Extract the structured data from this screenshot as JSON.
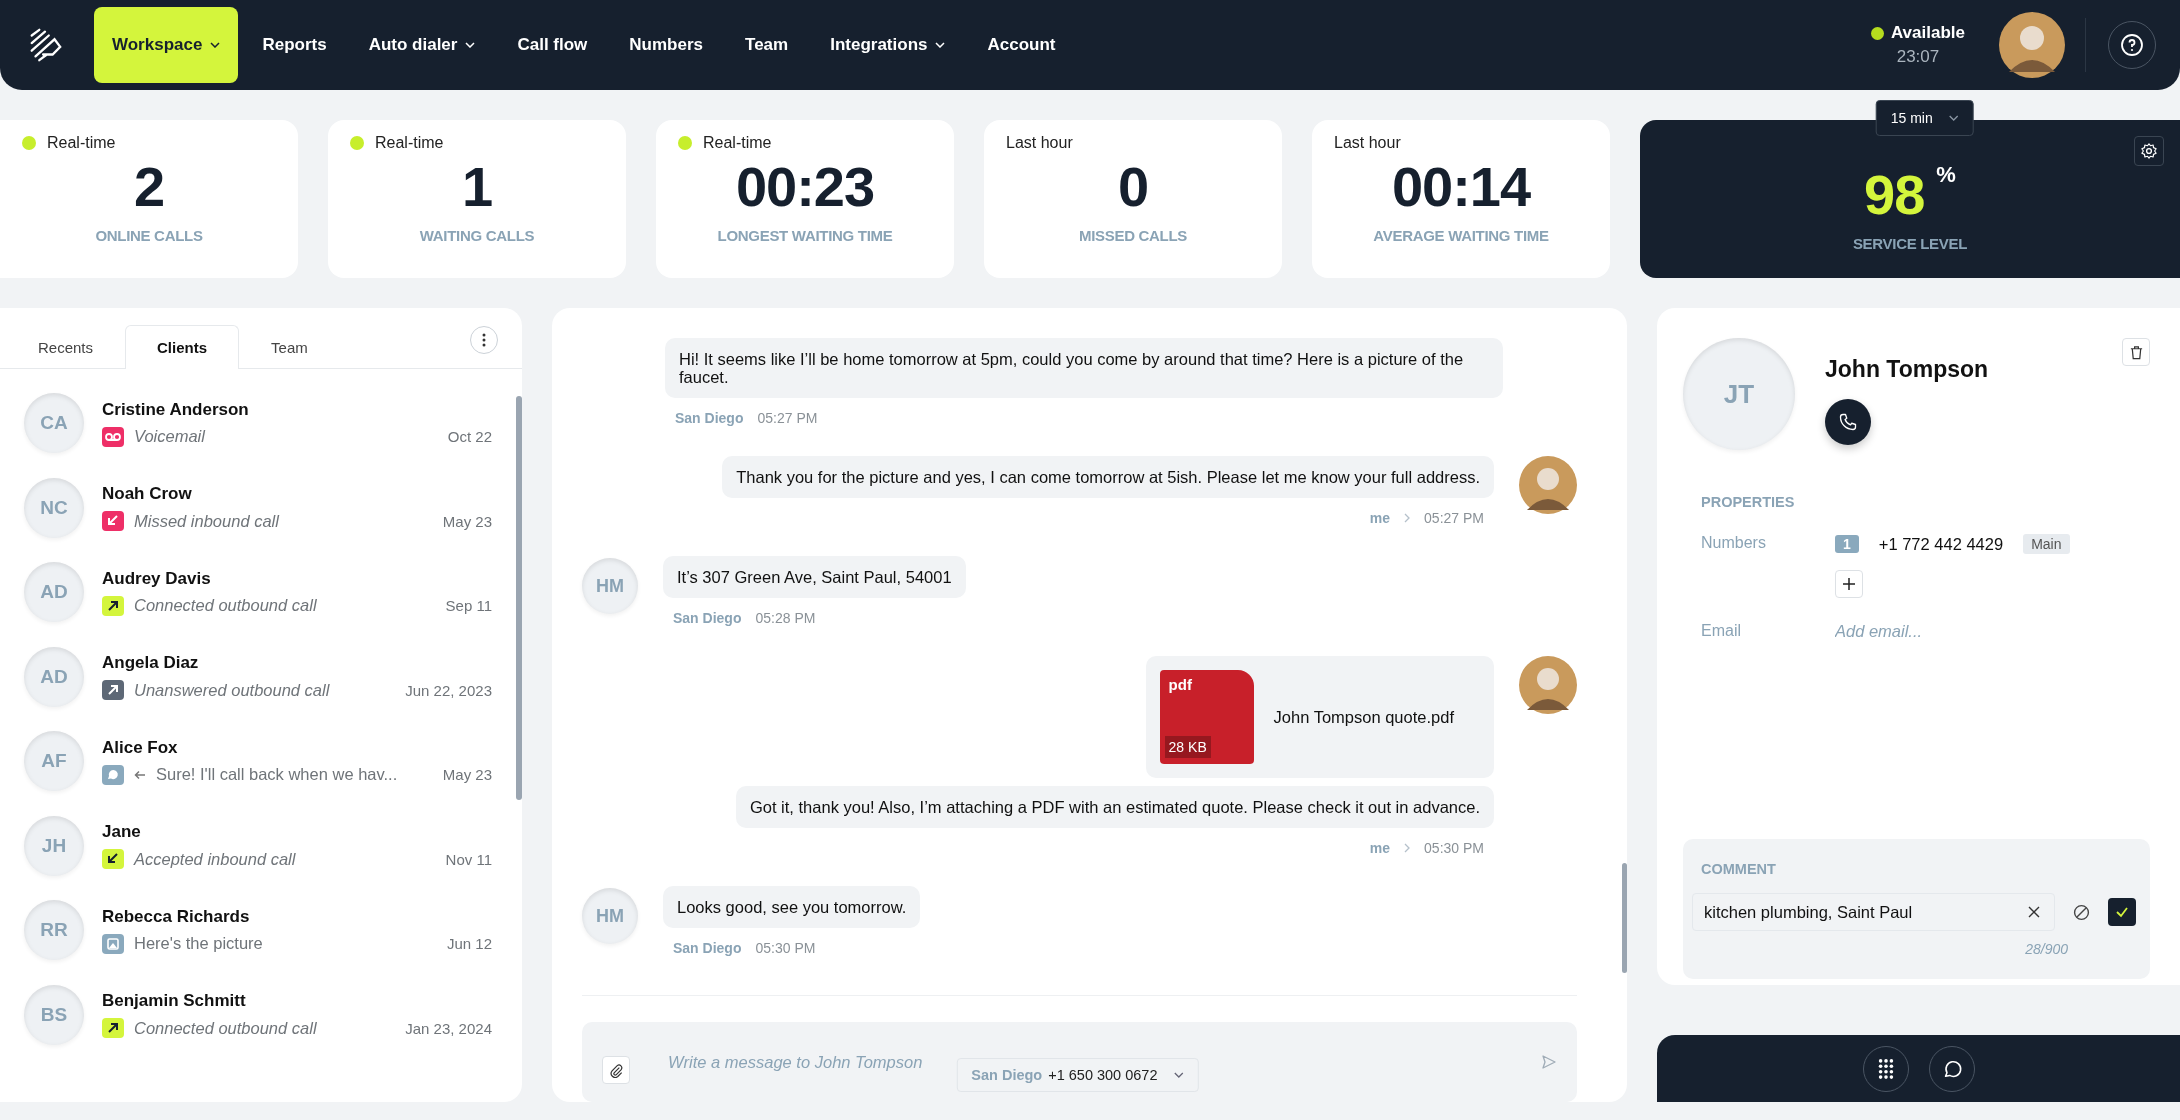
{
  "nav": {
    "items": [
      {
        "label": "Workspace",
        "selected": true,
        "dropdown": true
      },
      {
        "label": "Reports",
        "selected": false,
        "dropdown": false
      },
      {
        "label": "Auto dialer",
        "selected": false,
        "dropdown": true
      },
      {
        "label": "Call flow",
        "selected": false,
        "dropdown": false
      },
      {
        "label": "Numbers",
        "selected": false,
        "dropdown": false
      },
      {
        "label": "Team",
        "selected": false,
        "dropdown": false
      },
      {
        "label": "Integrations",
        "selected": false,
        "dropdown": true
      },
      {
        "label": "Account",
        "selected": false,
        "dropdown": false
      }
    ],
    "status": {
      "label": "Available",
      "time": "23:07",
      "color": "#b5dc1e"
    }
  },
  "stats": [
    {
      "period": "Real-time",
      "live": true,
      "value": "2",
      "label": "ONLINE CALLS"
    },
    {
      "period": "Real-time",
      "live": true,
      "value": "1",
      "label": "WAITING CALLS"
    },
    {
      "period": "Real-time",
      "live": true,
      "value": "00:23",
      "label": "LONGEST WAITING TIME"
    },
    {
      "period": "Last hour",
      "live": false,
      "value": "0",
      "label": "MISSED CALLS"
    },
    {
      "period": "Last hour",
      "live": false,
      "value": "00:14",
      "label": "AVERAGE WAITING TIME"
    }
  ],
  "service_level": {
    "interval": "15 min",
    "value": "98",
    "unit": "%",
    "label": "SERVICE LEVEL"
  },
  "contacts": {
    "tabs": [
      {
        "label": "Recents",
        "selected": false
      },
      {
        "label": "Clients",
        "selected": true
      },
      {
        "label": "Team",
        "selected": false
      }
    ],
    "items": [
      {
        "initials": "CA",
        "name": "Cristine Anderson",
        "kind": "voicemail",
        "status": "Voicemail",
        "date": "Oct 22"
      },
      {
        "initials": "NC",
        "name": "Noah Crow",
        "kind": "missed_inbound",
        "status": "Missed inbound call",
        "date": "May 23"
      },
      {
        "initials": "AD",
        "name": "Audrey Davis",
        "kind": "connected_outbound",
        "status": "Connected outbound call",
        "date": "Sep 11"
      },
      {
        "initials": "AD",
        "name": "Angela Diaz",
        "kind": "unanswered_outbound",
        "status": "Unanswered outbound call",
        "date": "Jun 22, 2023"
      },
      {
        "initials": "AF",
        "name": "Alice Fox",
        "kind": "message",
        "status": "Sure! I'll call back when we hav...",
        "date": "May 23"
      },
      {
        "initials": "JH",
        "name": "Jane",
        "kind": "accepted_inbound",
        "status": "Accepted inbound call",
        "date": "Nov 11"
      },
      {
        "initials": "RR",
        "name": "Rebecca Richards",
        "kind": "image",
        "status": "Here's the picture",
        "date": "Jun 12"
      },
      {
        "initials": "BS",
        "name": "Benjamin Schmitt",
        "kind": "connected_outbound",
        "status": "Connected outbound call",
        "date": "Jan 23, 2024"
      }
    ]
  },
  "chat": {
    "groups": [
      {
        "kind": "client",
        "avatar": false,
        "sender": "San Diego",
        "time": "05:27 PM",
        "items": [
          {
            "kind": "text",
            "text": "Hi! It seems like I’ll be home tomorrow at 5pm, could you come by around that time? Here is a picture of the faucet."
          }
        ]
      },
      {
        "kind": "me",
        "avatar": true,
        "sender": "me",
        "time": "05:27 PM",
        "items": [
          {
            "kind": "text",
            "text": "Thank you for the picture and yes, I can come tomorrow at 5ish. Please let me know your full address."
          }
        ]
      },
      {
        "kind": "client",
        "avatar": true,
        "initials": "HM",
        "sender": "San Diego",
        "time": "05:28 PM",
        "items": [
          {
            "kind": "text",
            "text": "It’s 307 Green Ave, Saint Paul, 54001"
          }
        ]
      },
      {
        "kind": "me",
        "avatar": true,
        "sender": "me",
        "time": "05:30 PM",
        "items": [
          {
            "kind": "file",
            "type": "pdf",
            "size": "28 KB",
            "name": "John Tompson quote.pdf"
          },
          {
            "kind": "text",
            "text": "Got it, thank you! Also, I’m attaching a PDF with an estimated quote. Please check it out in advance."
          }
        ]
      },
      {
        "kind": "client",
        "avatar": true,
        "initials": "HM",
        "sender": "San Diego",
        "time": "05:30 PM",
        "items": [
          {
            "kind": "text",
            "text": "Looks good, see you tomorrow."
          }
        ]
      }
    ],
    "compose": {
      "placeholder": "Write a message to John Tompson",
      "line_location": "San Diego",
      "line_number": "+1 650 300 0672"
    }
  },
  "contact": {
    "initials": "JT",
    "name": "John Tompson",
    "properties_heading": "PROPERTIES",
    "numbers_label": "Numbers",
    "numbers": [
      {
        "index": "1",
        "number": "+1 772 442 4429",
        "tag": "Main"
      }
    ],
    "email_label": "Email",
    "email_placeholder": "Add email...",
    "comment": {
      "heading": "COMMENT",
      "value": "kitchen plumbing, Saint Paul",
      "counter": "28/900"
    }
  }
}
